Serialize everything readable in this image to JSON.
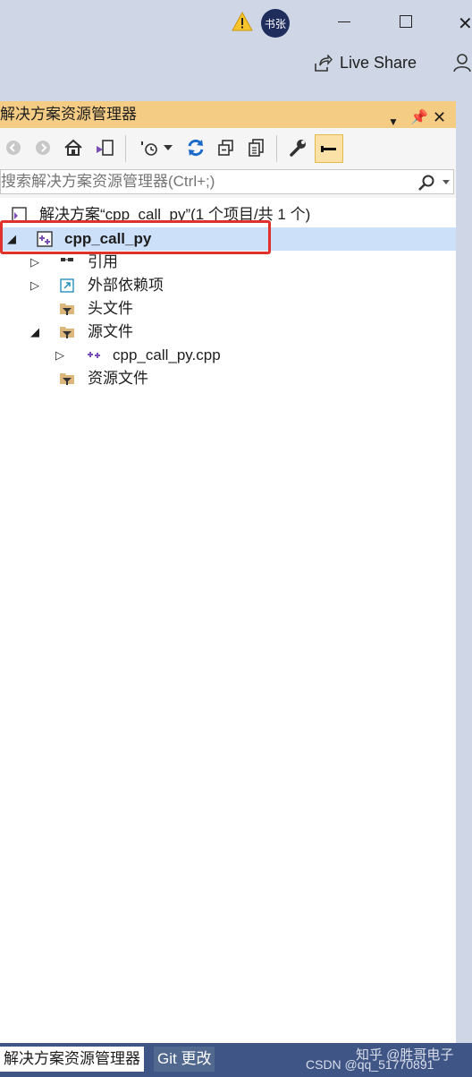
{
  "titlebar": {
    "user_initials": "书张",
    "liveshare_label": "Live Share"
  },
  "panel": {
    "title": "解决方案资源管理器",
    "search_placeholder": "搜索解决方案资源管理器(Ctrl+;)"
  },
  "tree": {
    "solution_label": "解决方案“cpp_call_py”(1 个项目/共 1 个)",
    "project_label": "cpp_call_py",
    "items": [
      {
        "label": "引用"
      },
      {
        "label": "外部依赖项"
      },
      {
        "label": "头文件"
      },
      {
        "label": "源文件"
      },
      {
        "label": "cpp_call_py.cpp"
      },
      {
        "label": "资源文件"
      }
    ]
  },
  "bottom": {
    "tab_active": "解决方案资源管理器",
    "tab_other": "Git 更改",
    "watermark_left": "CSDN @qq_51770891",
    "watermark_right": "知乎 @胜哥电子"
  },
  "colors": {
    "accent_title": "#f5cc84",
    "selection": "#cce0f9",
    "highlight_border": "#e0312c",
    "bottombar": "#3f5586"
  }
}
